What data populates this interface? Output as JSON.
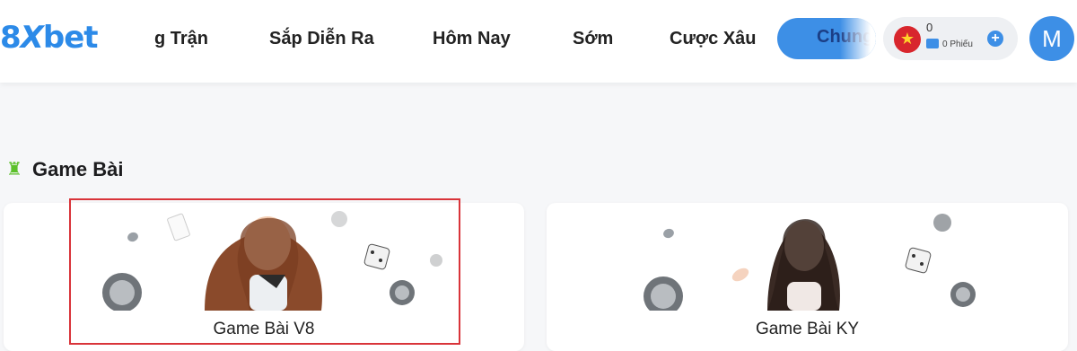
{
  "header": {
    "logo": {
      "part1": "8",
      "part2": "X",
      "part3": "bet"
    },
    "nav": [
      {
        "label": "g Trận"
      },
      {
        "label": "Sắp Diễn Ra"
      },
      {
        "label": "Hôm Nay"
      },
      {
        "label": "Sớm"
      },
      {
        "label": "Cược Xâu"
      },
      {
        "label": "Chung"
      }
    ],
    "wallet": {
      "balance": "0",
      "tickets": "0 Phiếu",
      "flag_icon": "vietnam-flag-icon",
      "add_icon": "plus-icon"
    },
    "avatar_letter": "M"
  },
  "section": {
    "icon": "chess-rook-icon",
    "title": "Game Bài"
  },
  "cards": [
    {
      "label": "Game Bài V8"
    },
    {
      "label": "Game Bài KY"
    }
  ],
  "colors": {
    "accent": "#3d8fe6",
    "highlight": "#d9343a",
    "section_icon": "#5cc02a"
  }
}
